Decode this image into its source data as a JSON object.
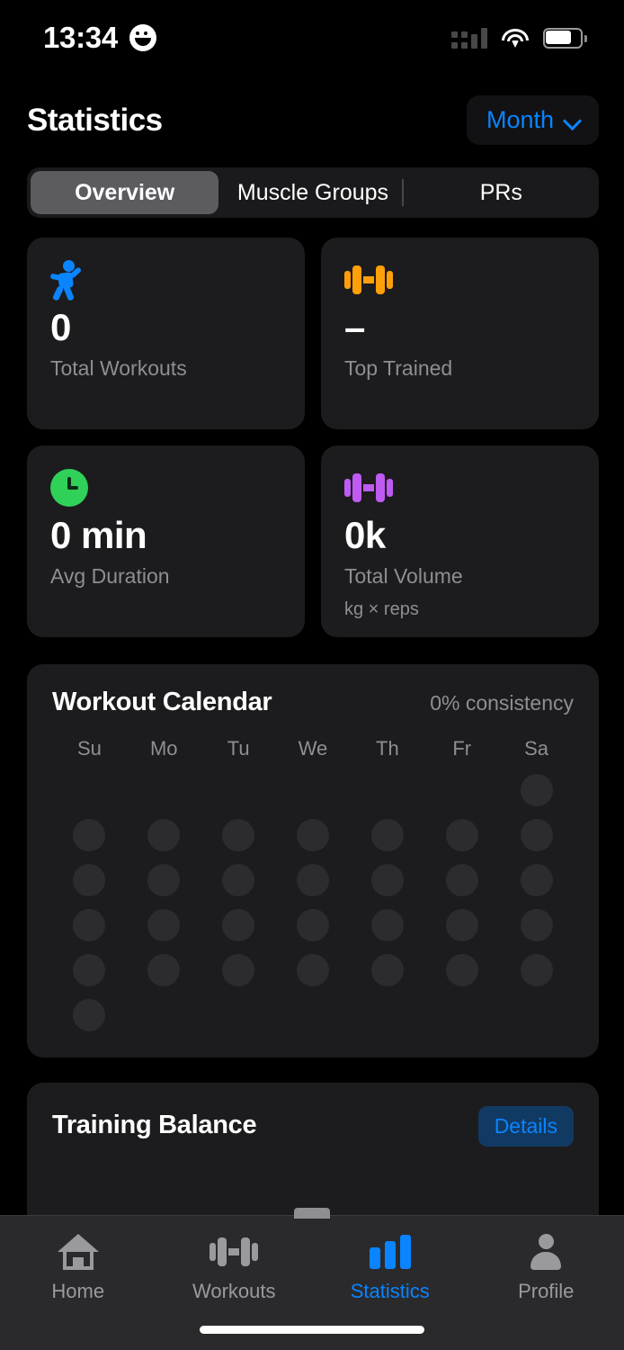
{
  "status_bar": {
    "time": "13:34",
    "emoji_icon": "smiley-face-icon",
    "signal_icon": "cellular-signal-icon",
    "wifi_icon": "wifi-icon",
    "battery_icon": "battery-icon"
  },
  "header": {
    "title": "Statistics",
    "period_label": "Month",
    "chevron_icon": "chevron-down-icon"
  },
  "segmented": {
    "tabs": [
      {
        "label": "Overview",
        "active": true
      },
      {
        "label": "Muscle Groups",
        "active": false
      },
      {
        "label": "PRs",
        "active": false
      }
    ]
  },
  "stats": [
    {
      "icon": "running-figure-icon",
      "icon_color": "#0a84ff",
      "value": "0",
      "label": "Total Workouts",
      "sublabel": ""
    },
    {
      "icon": "dumbbell-icon",
      "icon_color": "#ff9f0a",
      "value": "–",
      "label": "Top Trained",
      "sublabel": ""
    },
    {
      "icon": "clock-icon",
      "icon_color": "#30d158",
      "value": "0 min",
      "label": "Avg Duration",
      "sublabel": ""
    },
    {
      "icon": "dumbbell-icon",
      "icon_color": "#bf5af2",
      "value": "0k",
      "label": "Total Volume",
      "sublabel": "kg × reps"
    }
  ],
  "calendar": {
    "title": "Workout Calendar",
    "consistency": "0% consistency",
    "weekdays": [
      "Su",
      "Mo",
      "Tu",
      "We",
      "Th",
      "Fr",
      "Sa"
    ],
    "leading_blanks": 6,
    "days_in_month": 30,
    "active_days": []
  },
  "training_balance": {
    "title": "Training Balance",
    "details_label": "Details"
  },
  "tabbar": {
    "items": [
      {
        "label": "Home",
        "icon": "home-icon",
        "active": false
      },
      {
        "label": "Workouts",
        "icon": "dumbbell-icon",
        "active": false
      },
      {
        "label": "Statistics",
        "icon": "bar-chart-icon",
        "active": true
      },
      {
        "label": "Profile",
        "icon": "person-icon",
        "active": false
      }
    ]
  },
  "colors": {
    "accent": "#0a84ff",
    "background": "#000000",
    "card": "#1c1c1e",
    "muted_text": "#8e8e93"
  }
}
